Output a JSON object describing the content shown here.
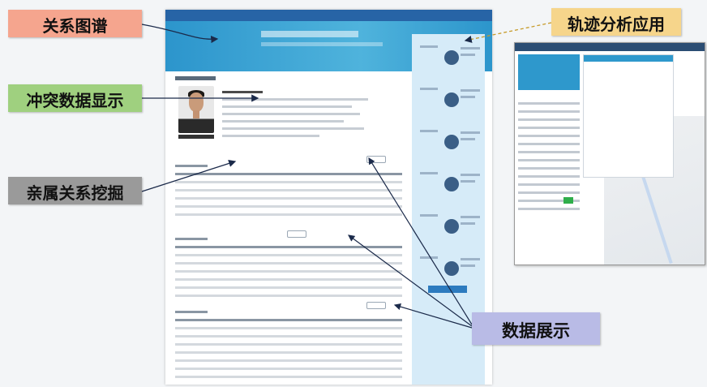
{
  "callouts": {
    "relation_graph": "关系图谱",
    "conflict_data": "冲突数据显示",
    "kinship_mining": "亲属关系挖掘",
    "trajectory_app": "轨迹分析应用",
    "data_display": "数据展示"
  },
  "colors": {
    "relation_graph": "#f5a58e",
    "conflict_data": "#9fd07f",
    "kinship_mining": "#9a9a9a",
    "trajectory_app": "#f6d58b",
    "data_display": "#b9bbe6",
    "banner": "#2c95cc",
    "side_panel": "#d6ebf8"
  },
  "icons": [
    "person-photo",
    "map-pin-icon",
    "avatar-circle-icon"
  ]
}
